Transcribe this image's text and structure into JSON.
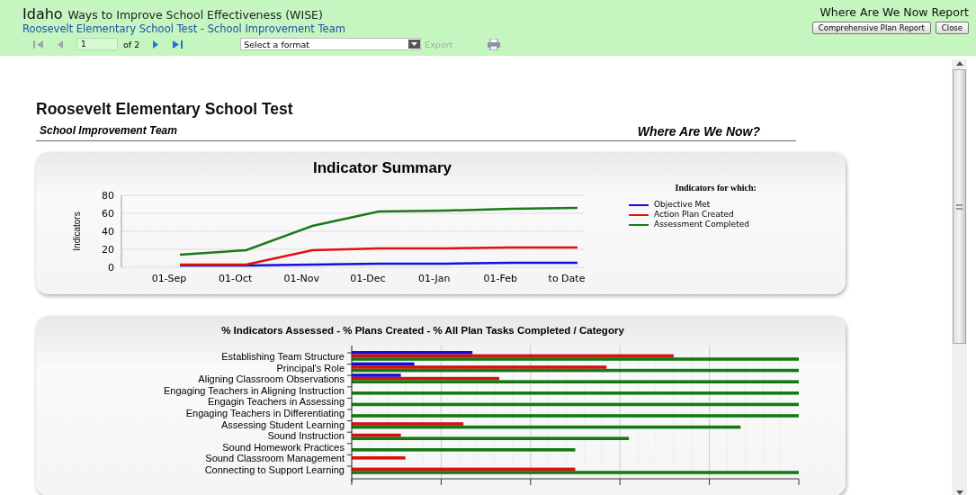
{
  "header": {
    "state": "Idaho",
    "program": "Ways to Improve School Effectiveness (WISE)",
    "subtitle": "Roosevelt Elementary School Test - School Improvement Team",
    "report_name": "Where Are We Now Report",
    "buttons": [
      "Comprehensive Plan Report",
      "Close"
    ]
  },
  "toolbar": {
    "page": "1",
    "page_count": "of 2",
    "format": "Select a format",
    "export": {
      "label": "Export",
      "disabled": true
    }
  },
  "report": {
    "title": "Roosevelt Elementary School Test",
    "team": "School Improvement Team",
    "heading": "Where Are We Now?"
  },
  "indicator_summary": {
    "legend_title": "Indicators for  which:",
    "chart_data": {
      "type": "line",
      "title": "Indicator Summary",
      "ylabel": "Indicators",
      "categories": [
        "01-Sep",
        "01-Oct",
        "01-Nov",
        "01-Dec",
        "01-Jan",
        "01-Feb",
        "to Date"
      ],
      "ylim": [
        0,
        80
      ],
      "grid": true,
      "yticks": [
        0,
        20,
        40,
        60,
        80
      ],
      "series": [
        {
          "name": "Objective Met",
          "color": "#1010e0",
          "values": [
            2,
            2,
            3,
            4,
            4,
            5,
            5
          ]
        },
        {
          "name": "Action Plan Created",
          "color": "#e01010",
          "values": [
            3,
            3,
            19,
            21,
            21,
            22,
            22
          ]
        },
        {
          "name": "Assessment Completed",
          "color": "#1a7a1a",
          "values": [
            14,
            19,
            46,
            62,
            63,
            65,
            66
          ]
        }
      ]
    }
  },
  "category_chart": {
    "title": "% Indicators Assessed  - % Plans Created  - % All Plan Tasks Completed / Category",
    "categories": [
      "Establishing Team Structure",
      "Principal's Role",
      "Aligning Classroom Observations",
      "Engaging Teachers in Aligning Instruction",
      "Engagin Teachers in Assessing",
      "Engaging Teachers in Differentiating",
      "Assessing Student Learning",
      "Sound Instruction",
      "Sound Homework Practices",
      "Sound Classroom Management",
      "Connecting to Support Learning"
    ]
  }
}
